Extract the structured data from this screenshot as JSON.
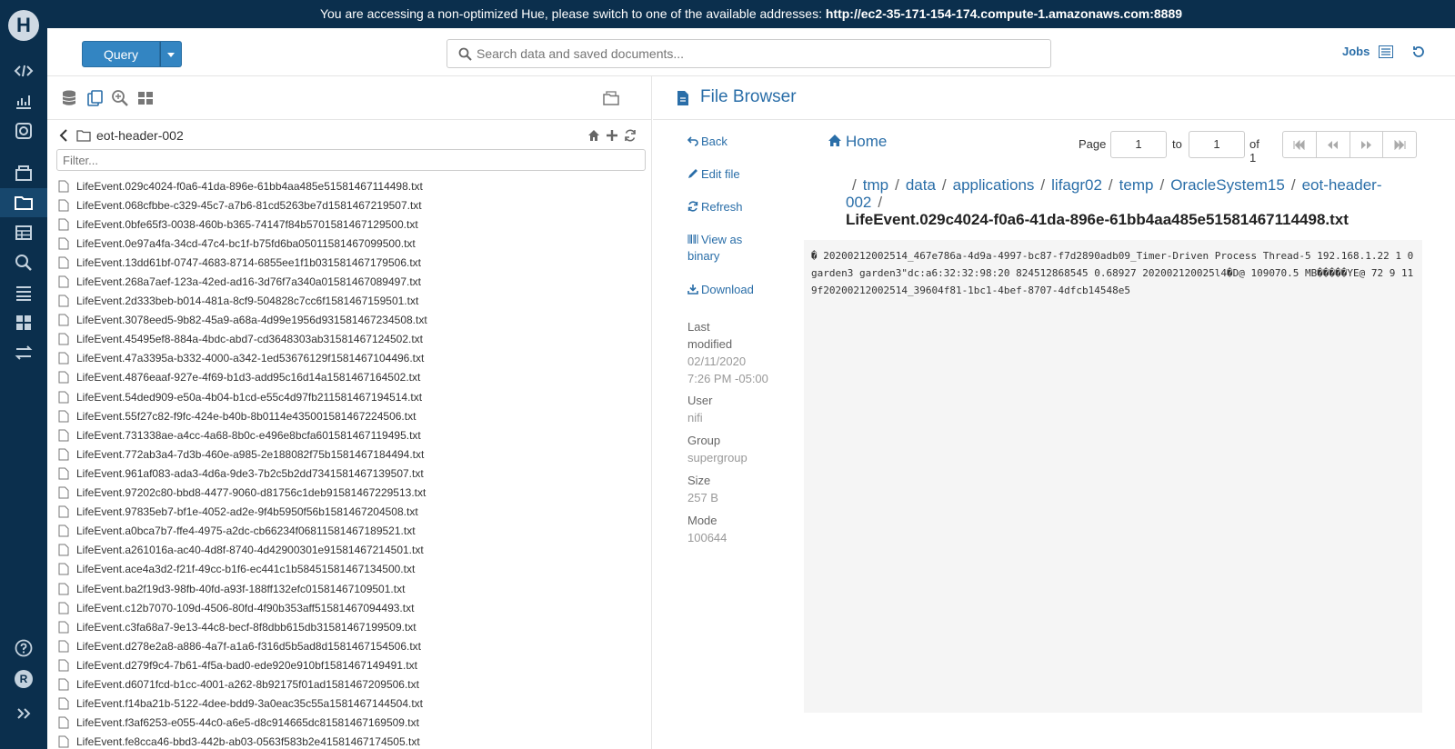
{
  "banner": {
    "text": "You are accessing a non-optimized Hue, please switch to one of the available addresses: ",
    "address": "http://ec2-35-171-154-174.compute-1.amazonaws.com:8889"
  },
  "topbar": {
    "query_label": "Query",
    "search_placeholder": "Search data and saved documents...",
    "jobs_label": "Jobs"
  },
  "nav": {
    "logo": "H",
    "avatar_initial": "R"
  },
  "assist": {
    "folder": "eot-header-002",
    "filter_placeholder": "Filter...",
    "files": [
      "LifeEvent.029c4024-f0a6-41da-896e-61bb4aa485e51581467114498.txt",
      "LifeEvent.068cfbbe-c329-45c7-a7b6-81cd5263be7d1581467219507.txt",
      "LifeEvent.0bfe65f3-0038-460b-b365-74147f84b5701581467129500.txt",
      "LifeEvent.0e97a4fa-34cd-47c4-bc1f-b75fd6ba05011581467099500.txt",
      "LifeEvent.13dd61bf-0747-4683-8714-6855ee1f1b031581467179506.txt",
      "LifeEvent.268a7aef-123a-42ed-ad16-3d76f7a340a01581467089497.txt",
      "LifeEvent.2d333beb-b014-481a-8cf9-504828c7cc6f1581467159501.txt",
      "LifeEvent.3078eed5-9b82-45a9-a68a-4d99e1956d931581467234508.txt",
      "LifeEvent.45495ef8-884a-4bdc-abd7-cd3648303ab31581467124502.txt",
      "LifeEvent.47a3395a-b332-4000-a342-1ed53676129f1581467104496.txt",
      "LifeEvent.4876eaaf-927e-4f69-b1d3-add95c16d14a1581467164502.txt",
      "LifeEvent.54ded909-e50a-4b04-b1cd-e55c4d97fb211581467194514.txt",
      "LifeEvent.55f27c82-f9fc-424e-b40b-8b0114e435001581467224506.txt",
      "LifeEvent.731338ae-a4cc-4a68-8b0c-e496e8bcfa601581467119495.txt",
      "LifeEvent.772ab3a4-7d3b-460e-a985-2e188082f75b1581467184494.txt",
      "LifeEvent.961af083-ada3-4d6a-9de3-7b2c5b2dd7341581467139507.txt",
      "LifeEvent.97202c80-bbd8-4477-9060-d81756c1deb91581467229513.txt",
      "LifeEvent.97835eb7-bf1e-4052-ad2e-9f4b5950f56b1581467204508.txt",
      "LifeEvent.a0bca7b7-ffe4-4975-a2dc-cb66234f06811581467189521.txt",
      "LifeEvent.a261016a-ac40-4d8f-8740-4d42900301e91581467214501.txt",
      "LifeEvent.ace4a3d2-f21f-49cc-b1f6-ec441c1b58451581467134500.txt",
      "LifeEvent.ba2f19d3-98fb-40fd-a93f-188ff132efc01581467109501.txt",
      "LifeEvent.c12b7070-109d-4506-80fd-4f90b353aff51581467094493.txt",
      "LifeEvent.c3fa68a7-9e13-44c8-becf-8f8dbb615db31581467199509.txt",
      "LifeEvent.d278e2a8-a886-4a7f-a1a6-f316d5b5ad8d1581467154506.txt",
      "LifeEvent.d279f9c4-7b61-4f5a-bad0-ede920e910bf1581467149491.txt",
      "LifeEvent.d6071fcd-b1cc-4001-a262-8b92175f01ad1581467209506.txt",
      "LifeEvent.f14ba21b-5122-4dee-bdd9-3a0eac35c55a1581467144504.txt",
      "LifeEvent.f3af6253-e055-44c0-a6e5-d8c914665dc81581467169509.txt",
      "LifeEvent.fe8cca46-bbd3-442b-ab03-0563f583b2e41581467174505.txt"
    ]
  },
  "file_browser": {
    "title": "File Browser",
    "actions": {
      "back": "Back",
      "edit": "Edit file",
      "refresh": "Refresh",
      "view_binary_1": "View as",
      "view_binary_2": "binary",
      "download": "Download"
    },
    "meta": {
      "last_modified_label_1": "Last",
      "last_modified_label_2": "modified",
      "last_modified_date": "02/11/2020",
      "last_modified_time": "7:26 PM -05:00",
      "user_label": "User",
      "user": "nifi",
      "group_label": "Group",
      "group": "supergroup",
      "size_label": "Size",
      "size": "257 B",
      "mode_label": "Mode",
      "mode": "100644"
    },
    "home_label": "Home",
    "pager": {
      "page_label": "Page",
      "from": "1",
      "to_label": "to",
      "to": "1",
      "of": "of 1"
    },
    "breadcrumbs": [
      "tmp",
      "data",
      "applications",
      "lifagr02",
      "temp",
      "OracleSystem15",
      "eot-header-002"
    ],
    "current_file": "LifeEvent.029c4024-f0a6-41da-896e-61bb4aa485e51581467114498.txt",
    "content": "� 20200212002514_467e786a-4d9a-4997-bc87-f7d2890adb09_Timer-Driven Process Thread-5 192.168.1.22 1 0 garden3 garden3\"dc:a6:32:32:98:20 824512868545 0.68927 202002120025l4�D@ 109070.5 MB�����YE@ 72 9 119f20200212002514_39604f81-1bc1-4bef-8707-4dfcb14548e5"
  }
}
